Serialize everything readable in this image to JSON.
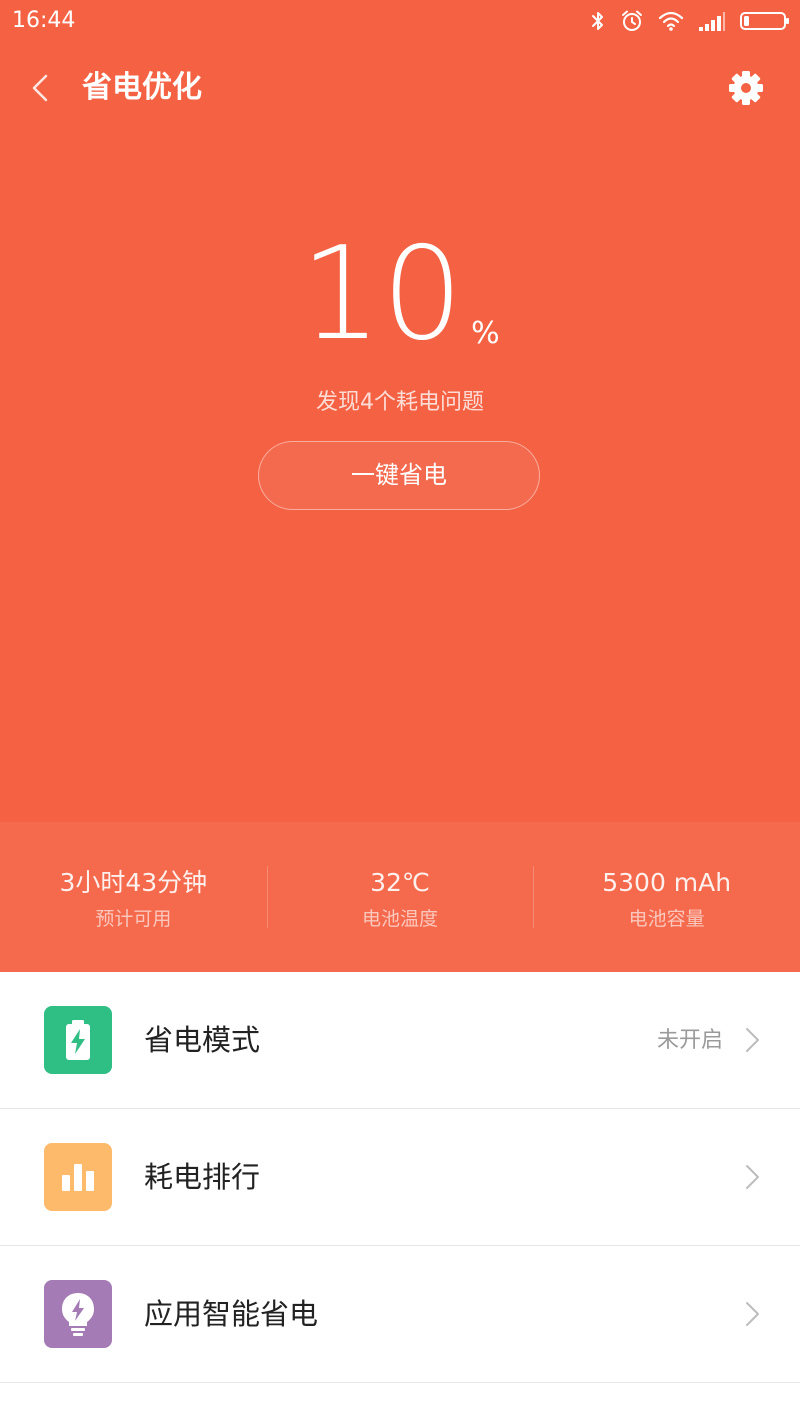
{
  "status_bar": {
    "time": "16:44"
  },
  "header": {
    "title": "省电优化"
  },
  "battery": {
    "percent": "10",
    "percent_sign": "%",
    "issue_text": "发现4个耗电问题",
    "optimize_button": "一键省电"
  },
  "stats": [
    {
      "value": "3小时43分钟",
      "label": "预计可用"
    },
    {
      "value": "32℃",
      "label": "电池温度"
    },
    {
      "value": "5300 mAh",
      "label": "电池容量"
    }
  ],
  "menu": [
    {
      "label": "省电模式",
      "status": "未开启",
      "icon": "battery-charging-icon",
      "color": "#2FBE84"
    },
    {
      "label": "耗电排行",
      "status": "",
      "icon": "bar-chart-icon",
      "color": "#FDBA6A"
    },
    {
      "label": "应用智能省电",
      "status": "",
      "icon": "lightbulb-bolt-icon",
      "color": "#A47BB5"
    }
  ],
  "colors": {
    "primary": "#F46143",
    "stats_bg": "#F5694C"
  }
}
